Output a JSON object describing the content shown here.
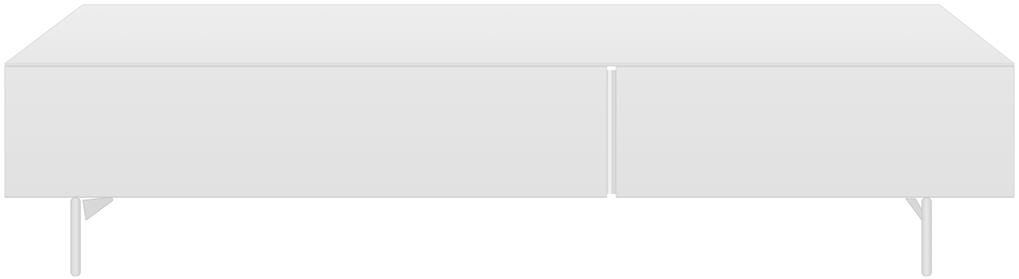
{
  "image": {
    "subject": "tv-bench",
    "colors": {
      "background": "#ffffff",
      "top_surface": "#ececec",
      "front_panel": "#e4e4e4",
      "edge": "#d2d2d2",
      "gap": "#c8c8c8",
      "leg": "#e2e2e2",
      "leg_shadow": "#c9c9c9"
    },
    "components": {
      "drawers": [
        "left-drawer",
        "right-drawer"
      ],
      "legs": [
        "front-left-leg",
        "back-left-leg",
        "front-right-leg",
        "back-right-leg"
      ]
    }
  }
}
